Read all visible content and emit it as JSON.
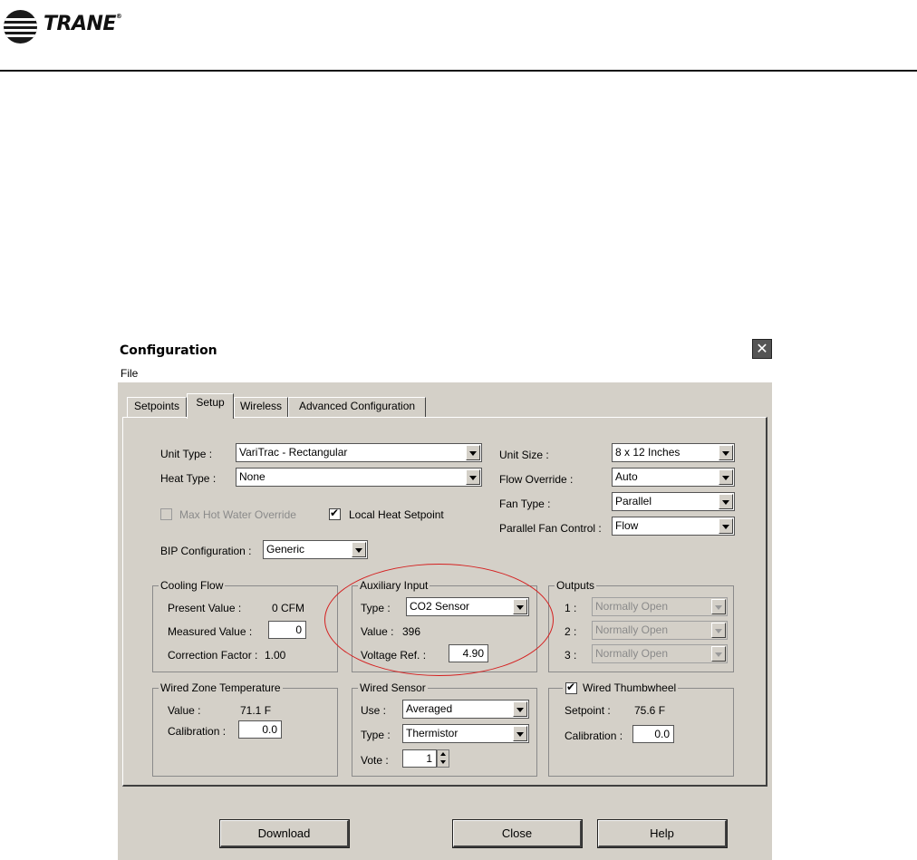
{
  "header": {
    "brand": "TRANE"
  },
  "window": {
    "title": "Configuration",
    "close_glyph": "✕",
    "menu": {
      "file": "File"
    }
  },
  "tabs": [
    "Setpoints",
    "Setup",
    "Wireless",
    "Advanced Configuration"
  ],
  "active_tab": "Setup",
  "setup": {
    "unit_type": {
      "label": "Unit Type :",
      "value": "VariTrac - Rectangular"
    },
    "heat_type": {
      "label": "Heat Type :",
      "value": "None"
    },
    "unit_size": {
      "label": "Unit Size :",
      "value": "8 x 12 Inches"
    },
    "flow_override": {
      "label": "Flow Override :",
      "value": "Auto"
    },
    "fan_type": {
      "label": "Fan Type :",
      "value": "Parallel"
    },
    "parallel_fan_control": {
      "label": "Parallel Fan Control :",
      "value": "Flow"
    },
    "max_hot_water_override": {
      "label": "Max Hot Water Override",
      "checked": false,
      "enabled": false
    },
    "local_heat_setpoint": {
      "label": "Local Heat Setpoint",
      "checked": true,
      "check_glyph": "✔"
    },
    "bip_configuration": {
      "label": "BIP Configuration :",
      "value": "Generic"
    }
  },
  "cooling_flow": {
    "title": "Cooling Flow",
    "present_value_label": "Present Value :",
    "present_value": "0 CFM",
    "measured_value_label": "Measured Value :",
    "measured_value": "0",
    "correction_factor_label": "Correction Factor :",
    "correction_factor": "1.00"
  },
  "auxiliary_input": {
    "title": "Auxiliary Input",
    "type_label": "Type :",
    "type_value": "CO2 Sensor",
    "value_label": "Value :",
    "value": "396",
    "voltage_ref_label": "Voltage Ref. :",
    "voltage_ref": "4.90"
  },
  "outputs": {
    "title": "Outputs",
    "rows": [
      {
        "label": "1 :",
        "value": "Normally Open"
      },
      {
        "label": "2 :",
        "value": "Normally Open"
      },
      {
        "label": "3 :",
        "value": "Normally Open"
      }
    ]
  },
  "wired_zone_temperature": {
    "title": "Wired Zone Temperature",
    "value_label": "Value :",
    "value": "71.1 F",
    "calibration_label": "Calibration :",
    "calibration": "0.0"
  },
  "wired_sensor": {
    "title": "Wired Sensor",
    "use_label": "Use :",
    "use_value": "Averaged",
    "type_label": "Type :",
    "type_value": "Thermistor",
    "vote_label": "Vote :",
    "vote_value": "1"
  },
  "wired_thumbwheel": {
    "title": "Wired Thumbwheel",
    "checked": true,
    "check_glyph": "✔",
    "setpoint_label": "Setpoint :",
    "setpoint": "75.6 F",
    "calibration_label": "Calibration :",
    "calibration": "0.0"
  },
  "buttons": {
    "download": "Download",
    "close": "Close",
    "help": "Help"
  },
  "colors": {
    "dialog_face": "#d4d0c8",
    "highlight_ellipse": "#d42020"
  }
}
